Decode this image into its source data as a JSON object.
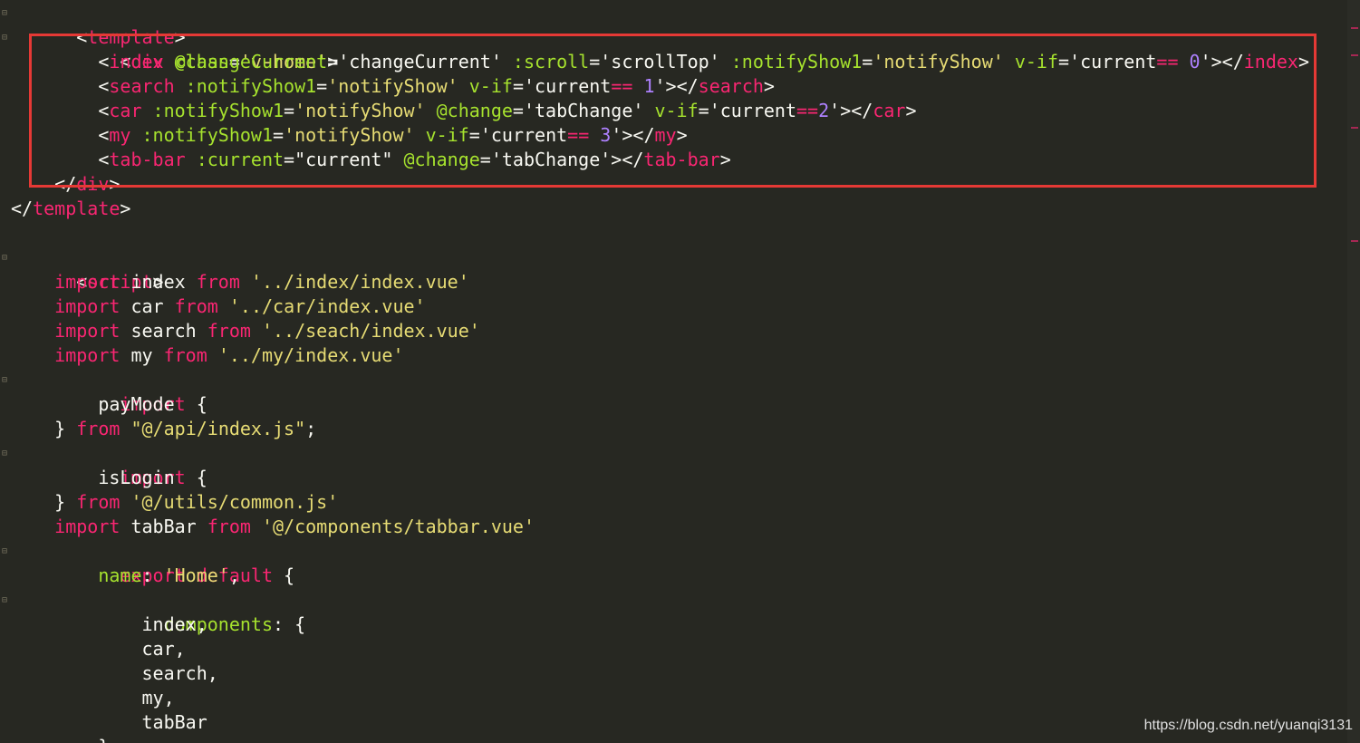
{
  "watermark": "https://blog.csdn.net/yuanqi3131",
  "code": {
    "l1": {
      "a": "<",
      "b": "template",
      "c": ">"
    },
    "l2": {
      "a": "<",
      "b": "div",
      "c": " class",
      "d": "=",
      "e": "'v-home'",
      "f": ">"
    },
    "l3": {
      "a": "<",
      "b": "index",
      "c": " @changeCurrent",
      "d": "=",
      "e": "'changeCurrent'",
      "f": " :scroll",
      "g": "=",
      "h": "'scrollTop'",
      "i": " :notifyShow1",
      "j": "=",
      "k": "'notifyShow'",
      "l": " v-if",
      "m": "=",
      "n": "'current",
      "o": "==",
      "p": " 0",
      "q": "'",
      "r": "></",
      "s": "index",
      "t": ">"
    },
    "l4": {
      "a": "<",
      "b": "search",
      "c": " :notifyShow1",
      "d": "=",
      "e": "'notifyShow'",
      "f": " v-if",
      "g": "=",
      "h": "'current",
      "i": "==",
      "j": " 1",
      "k": "'",
      "l": "></",
      "m": "search",
      "n": ">"
    },
    "l5": {
      "a": "<",
      "b": "car",
      "c": " :notifyShow1",
      "d": "=",
      "e": "'notifyShow'",
      "f": " @change",
      "g": "=",
      "h": "'tabChange'",
      "i": " v-if",
      "j": "=",
      "k": "'current",
      "l": "==",
      "m": "2",
      "n": "'",
      "o": "></",
      "p": "car",
      "q": ">"
    },
    "l6": {
      "a": "<",
      "b": "my",
      "c": " :notifyShow1",
      "d": "=",
      "e": "'notifyShow'",
      "f": " v-if",
      "g": "=",
      "h": "'current",
      "i": "==",
      "j": " 3",
      "k": "'",
      "l": "></",
      "m": "my",
      "n": ">"
    },
    "l7": {
      "a": "<",
      "b": "tab-bar",
      "c": " :current",
      "d": "=",
      "e": "\"current\"",
      "f": " @change",
      "g": "=",
      "h": "'tabChange'",
      "i": "></",
      "j": "tab-bar",
      "k": ">"
    },
    "l8": {
      "a": "</",
      "b": "div",
      "c": ">"
    },
    "l9": {
      "a": "</",
      "b": "template",
      "c": ">"
    },
    "l11": {
      "a": "<",
      "b": "script",
      "c": ">"
    },
    "l12": {
      "a": "import",
      "b": " index ",
      "c": "from",
      "d": " ",
      "e": "'../index/index.vue'"
    },
    "l13": {
      "a": "import",
      "b": " car ",
      "c": "from",
      "d": " ",
      "e": "'../car/index.vue'"
    },
    "l14": {
      "a": "import",
      "b": " search ",
      "c": "from",
      "d": " ",
      "e": "'../seach/index.vue'"
    },
    "l15": {
      "a": "import",
      "b": " my ",
      "c": "from",
      "d": " ",
      "e": "'../my/index.vue'"
    },
    "l16": {
      "a": "import",
      "b": " {"
    },
    "l17": {
      "a": "payMode"
    },
    "l18": {
      "a": "} ",
      "b": "from",
      "c": " ",
      "d": "\"@/api/index.js\"",
      "e": ";"
    },
    "l19": {
      "a": "import",
      "b": " {"
    },
    "l20": {
      "a": "isLogin"
    },
    "l21": {
      "a": "} ",
      "b": "from",
      "c": " ",
      "d": "'@/utils/common.js'"
    },
    "l22": {
      "a": "import",
      "b": " tabBar ",
      "c": "from",
      "d": " ",
      "e": "'@/components/tabbar.vue'"
    },
    "l23": {
      "a": "export",
      "b": " ",
      "c": "default",
      "d": " {"
    },
    "l24": {
      "a": "name",
      "b": ": ",
      "c": "'Home'",
      "d": ","
    },
    "l25": {
      "a": "components",
      "b": ": {"
    },
    "l26": {
      "a": "index,"
    },
    "l27": {
      "a": "car,"
    },
    "l28": {
      "a": "search,"
    },
    "l29": {
      "a": "my,"
    },
    "l30": {
      "a": "tabBar"
    },
    "l31": {
      "a": "},"
    }
  }
}
